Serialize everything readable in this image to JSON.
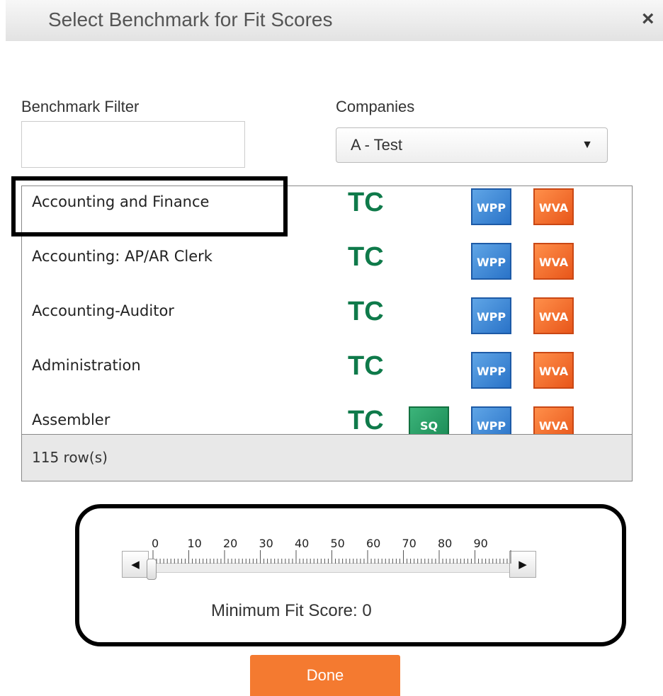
{
  "dialog": {
    "title": "Select Benchmark for Fit Scores",
    "close_icon": "×"
  },
  "filter": {
    "label": "Benchmark Filter",
    "value": "",
    "placeholder": ""
  },
  "companies": {
    "label": "Companies",
    "selected": "A - Test",
    "arrow": "▼"
  },
  "benchmarks": [
    {
      "name": "Accounting and Finance",
      "tc": "TC",
      "sq": "",
      "wpp": "WPP",
      "wva": "WVA"
    },
    {
      "name": "Accounting: AP/AR Clerk",
      "tc": "TC",
      "sq": "",
      "wpp": "WPP",
      "wva": "WVA"
    },
    {
      "name": "Accounting-Auditor",
      "tc": "TC",
      "sq": "",
      "wpp": "WPP",
      "wva": "WVA"
    },
    {
      "name": "Administration",
      "tc": "TC",
      "sq": "",
      "wpp": "WPP",
      "wva": "WVA"
    },
    {
      "name": "Assembler",
      "tc": "TC",
      "sq": "SQ",
      "wpp": "WPP",
      "wva": "WVA"
    }
  ],
  "row_count": "115 row(s)",
  "slider": {
    "ticks": [
      "0",
      "10",
      "20",
      "30",
      "40",
      "50",
      "60",
      "70",
      "80",
      "90"
    ],
    "left_arrow": "◀",
    "right_arrow": "▶",
    "value": 0,
    "caption": "Minimum Fit Score: 0"
  },
  "done_label": "Done",
  "colors": {
    "tc_green": "#0f7a4a",
    "wpp_blue": "#2a73c8",
    "wva_orange": "#e8561a",
    "sq_green": "#1a8a55",
    "done_orange": "#f47a30"
  }
}
